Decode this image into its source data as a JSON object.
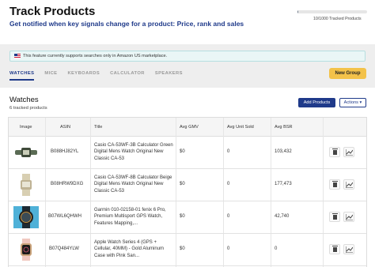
{
  "header": {
    "title": "Track Products",
    "subtitle": "Get notified when key signals change for a product: Price, rank and sales",
    "usage_label": "10/1000 Tracked Products",
    "usage_fraction": 0.01
  },
  "notice": {
    "icon": "us-flag-icon",
    "text": "This feature currently supports searches only in Amazon US marketplace."
  },
  "tabs": [
    {
      "label": "WATCHES",
      "active": true
    },
    {
      "label": "MICE",
      "active": false
    },
    {
      "label": "KEYBOARDS",
      "active": false
    },
    {
      "label": "CALCULATOR",
      "active": false
    },
    {
      "label": "SPEAKERS",
      "active": false
    }
  ],
  "new_group_label": "New Group",
  "section": {
    "title": "Watches",
    "count": "6 tracked products",
    "add_label": "Add Products",
    "actions_label": "Actions ▾"
  },
  "table": {
    "columns": [
      "Image",
      "ASIN",
      "Title",
      "Avg GMV",
      "Avg Unit Sold",
      "Avg BSR"
    ],
    "rows": [
      {
        "asin": "B088HJ82YL",
        "title": "Casio CA-53WF-3B Calculator Green Digital Mens Watch Original New Classic CA-53",
        "gmv": "$0",
        "units": "0",
        "bsr": "103,432"
      },
      {
        "asin": "B08HRW9DXG",
        "title": "Casio CA-53WF-8B Calculator Beige Digital Mens Watch Original New Classic CA-53",
        "gmv": "$0",
        "units": "0",
        "bsr": "177,473"
      },
      {
        "asin": "B07WL6QHWH",
        "title": "Garmin 010-02158-01 fenix 6 Pro, Premium Multisport GPS Watch, Features Mapping,...",
        "gmv": "$0",
        "units": "0",
        "bsr": "42,740"
      },
      {
        "asin": "B07Q484YLW",
        "title": "Apple Watch Series 4 (GPS + Cellular, 40MM) - Gold Aluminum Case with Pink San...",
        "gmv": "$0",
        "units": "0",
        "bsr": "0"
      }
    ],
    "row_icons": [
      "trash-icon",
      "chart-icon"
    ]
  }
}
